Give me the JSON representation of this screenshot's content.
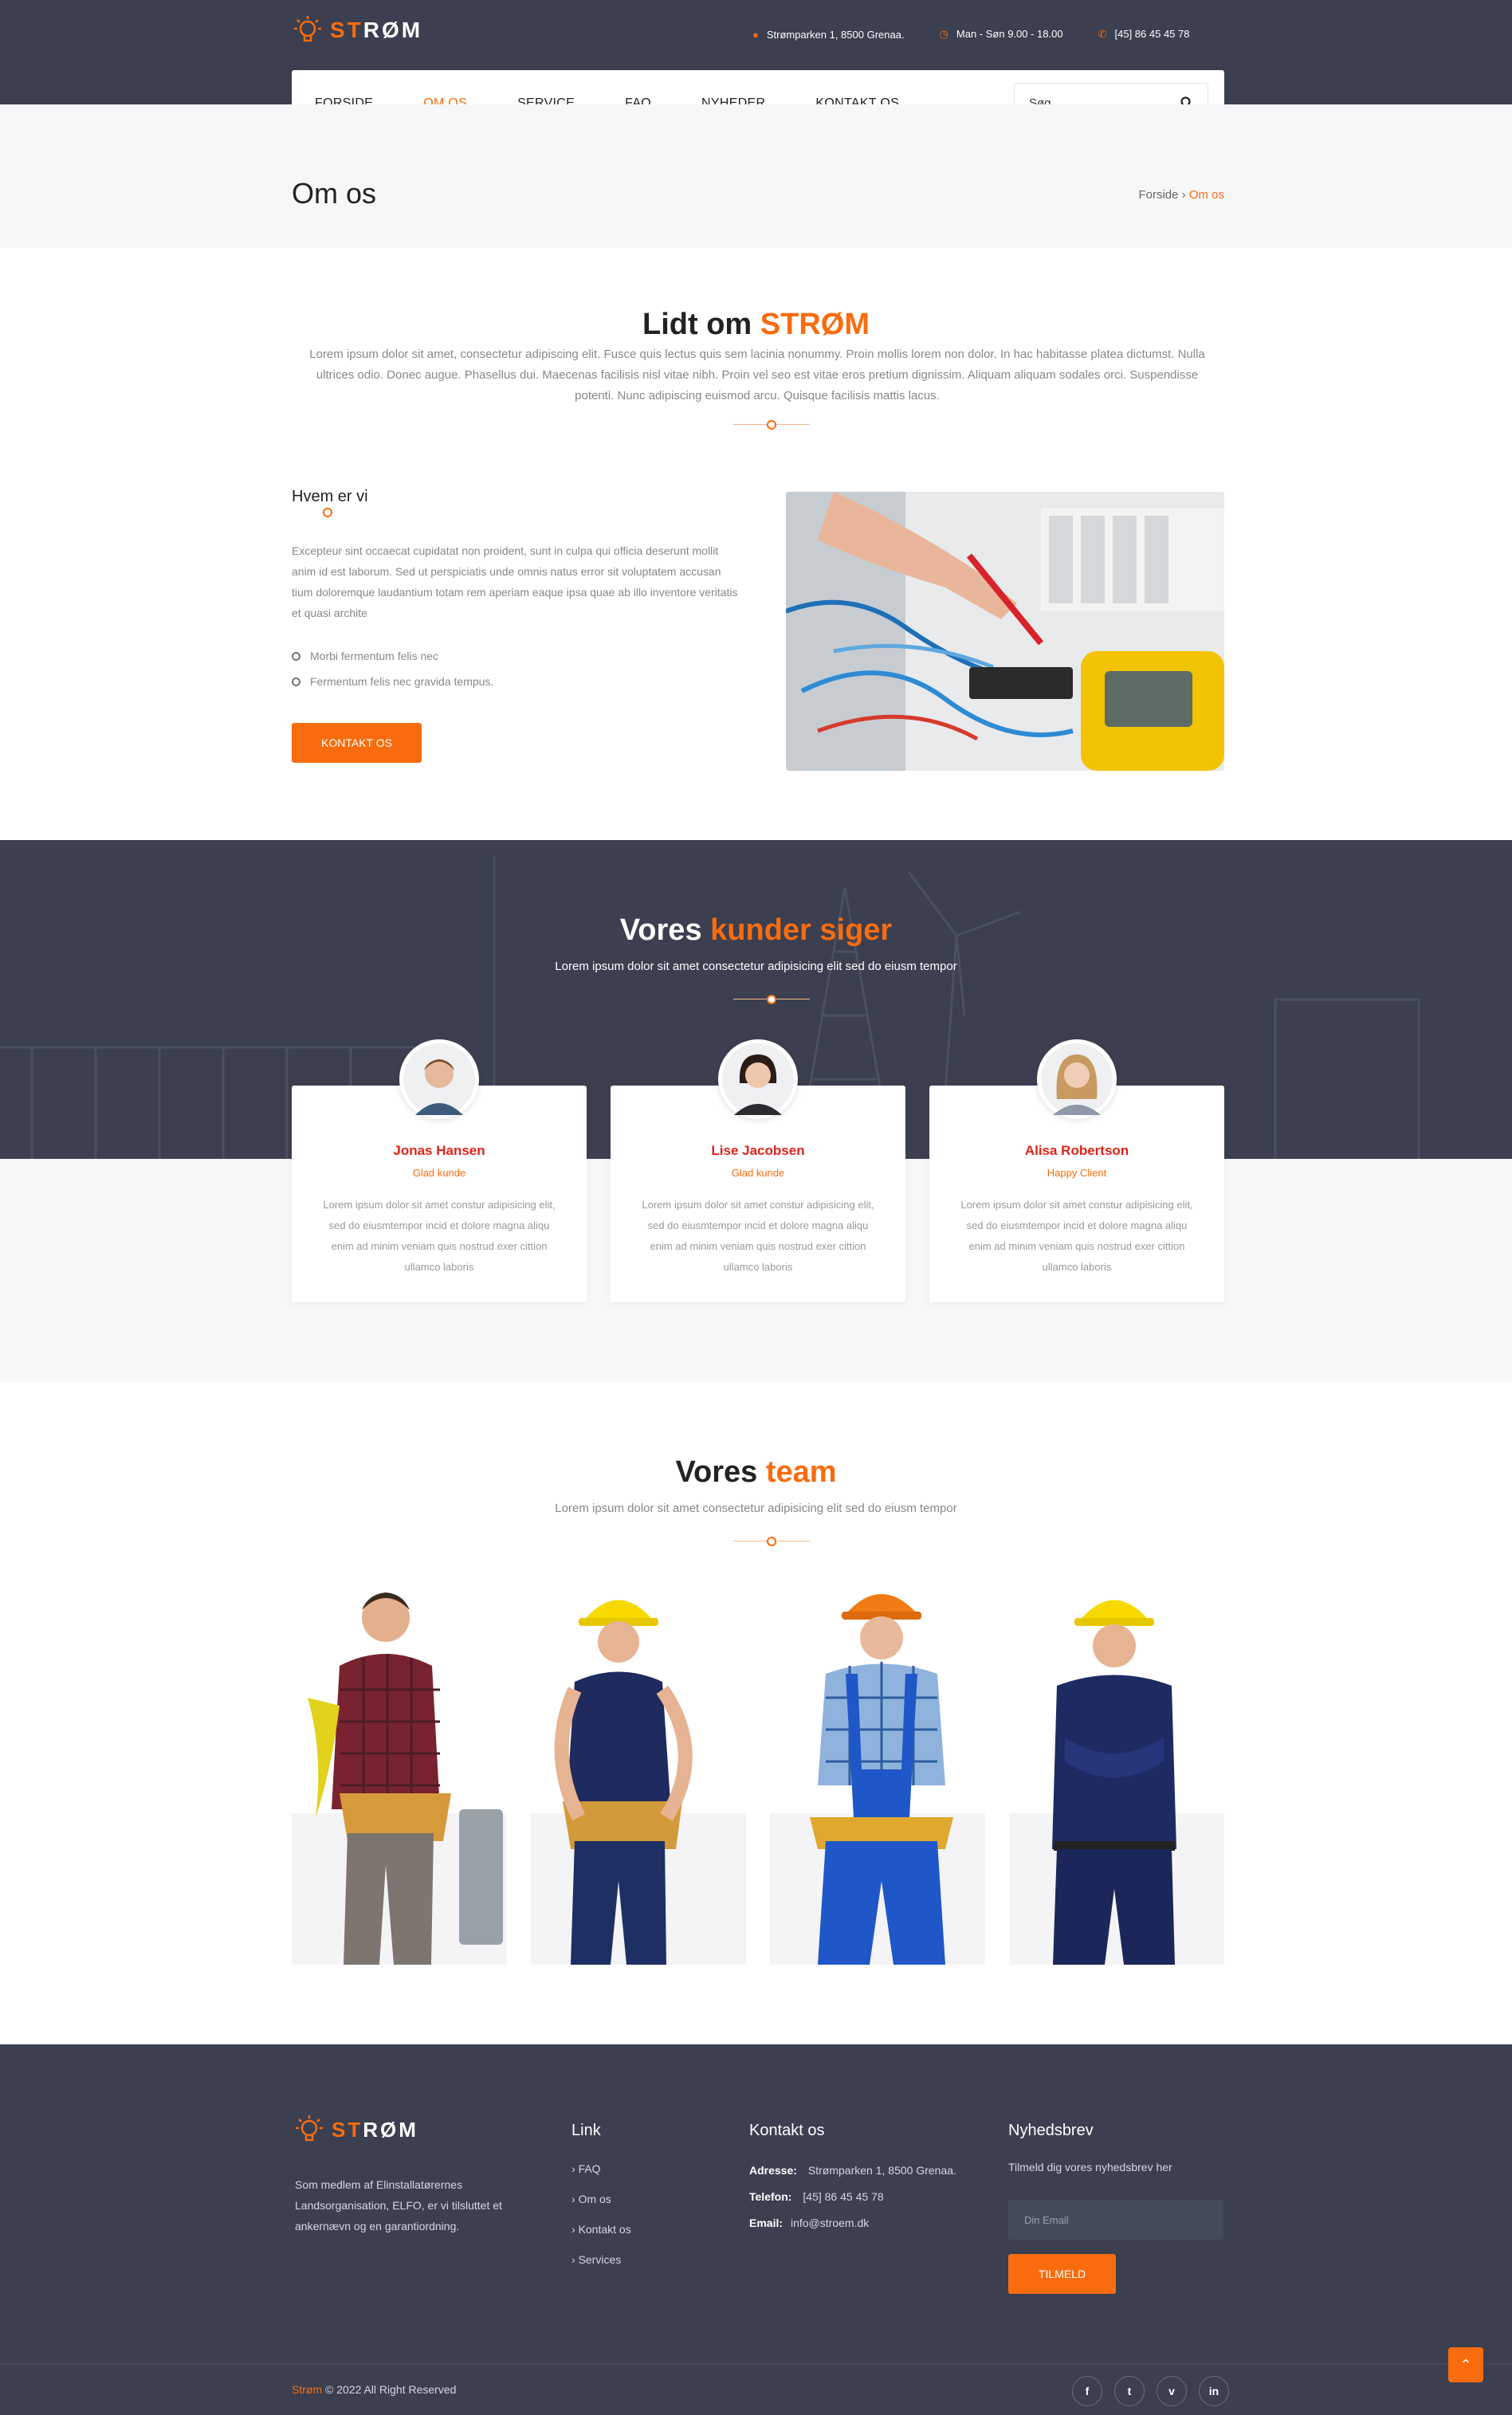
{
  "brand": {
    "name": "STRØM",
    "name_accent": "ST",
    "name_rest": "RØM"
  },
  "topbar": {
    "address": "Strømparken 1, 8500 Grenaa.",
    "hours": "Man - Søn 9.00 - 18.00",
    "phone": "[45] 86 45 45 78"
  },
  "nav": {
    "items": [
      "FORSIDE",
      "OM OS",
      "SERVICE",
      "FAQ",
      "NYHEDER",
      "KONTAKT OS"
    ],
    "active": "OM OS",
    "search_placeholder": "Søg"
  },
  "page": {
    "title": "Om os",
    "breadcrumb": [
      "Forside",
      "Om os"
    ]
  },
  "about": {
    "title_pre": "Lidt om ",
    "title_accent": "STRØM",
    "text": "Lorem ipsum dolor sit amet, consectetur adipiscing elit. Fusce quis lectus quis sem lacinia nonummy. Proin mollis lorem non dolor. In hac habitasse platea dictumst. Nulla ultrices odio. Donec augue. Phasellus dui. Maecenas facilisis nisl vitae nibh. Proin vel seo est vitae eros pretium dignissim. Aliquam aliquam sodales orci. Suspendisse potenti. Nunc adipiscing euismod arcu. Quisque facilisis mattis lacus.",
    "who_title": "Hvem er vi",
    "who_text": "Excepteur sint occaecat cupidatat non proident, sunt in culpa qui officia deserunt mollit anim id est laborum. Sed ut perspiciatis unde omnis natus error sit voluptatem accusan tium doloremque laudantium totam rem aperiam eaque ipsa quae ab illo inventore veritatis et quasi archite",
    "bullets": [
      "Morbi fermentum felis nec",
      "Fermentum felis nec gravida tempus."
    ],
    "button": "KONTAKT OS"
  },
  "testimonials": {
    "title_pre": "Vores ",
    "title_accent": "kunder siger",
    "subtitle": "Lorem ipsum dolor sit amet consectetur adipisicing elit sed do eiusm tempor",
    "items": [
      {
        "name": "Jonas Hansen",
        "role": "Glad kunde",
        "text": "Lorem ipsum dolor sit amet constur adipisicing elit, sed do eiusmtempor incid et dolore magna aliqu enim ad minim veniam quis nostrud exer cittion ullamco laboris"
      },
      {
        "name": "Lise Jacobsen",
        "role": "Glad kunde",
        "text": "Lorem ipsum dolor sit amet constur adipisicing elit, sed do eiusmtempor incid et dolore magna aliqu enim ad minim veniam quis nostrud exer cittion ullamco laboris"
      },
      {
        "name": "Alisa Robertson",
        "role": "Happy Client",
        "text": "Lorem ipsum dolor sit amet constur adipisicing elit, sed do eiusmtempor incid et dolore magna aliqu enim ad minim veniam quis nostrud exer cittion ullamco laboris"
      }
    ]
  },
  "team": {
    "title_pre": "Vores ",
    "title_accent": "team",
    "subtitle": "Lorem ipsum dolor sit amet consectetur adipisicing elit sed do eiusm tempor"
  },
  "footer": {
    "about": "Som medlem af Elinstallatørernes Landsorganisation, ELFO, er vi tilsluttet et ankernævn og en garantiordning.",
    "links_title": "Link",
    "links": [
      "FAQ",
      "Om os",
      "Kontakt os",
      "Services"
    ],
    "contact_title": "Kontakt os",
    "contact": [
      {
        "label": "Adresse:",
        "value": "Strømparken 1, 8500 Grenaa."
      },
      {
        "label": "Telefon:",
        "value": "[45] 86 45 45 78"
      },
      {
        "label": "Email:",
        "value": "info@stroem.dk"
      }
    ],
    "newsletter_title": "Nyhedsbrev",
    "newsletter_text": "Tilmeld dig vores nyhedsbrev her",
    "email_placeholder": "Din Email",
    "subscribe": "TILMELD",
    "copyright_brand": "Strøm",
    "copyright": " © 2022 All Right Reserved",
    "social": [
      "f",
      "t",
      "v",
      "in"
    ]
  },
  "colors": {
    "accent": "#f96c0e",
    "dark": "#3b3f50"
  }
}
